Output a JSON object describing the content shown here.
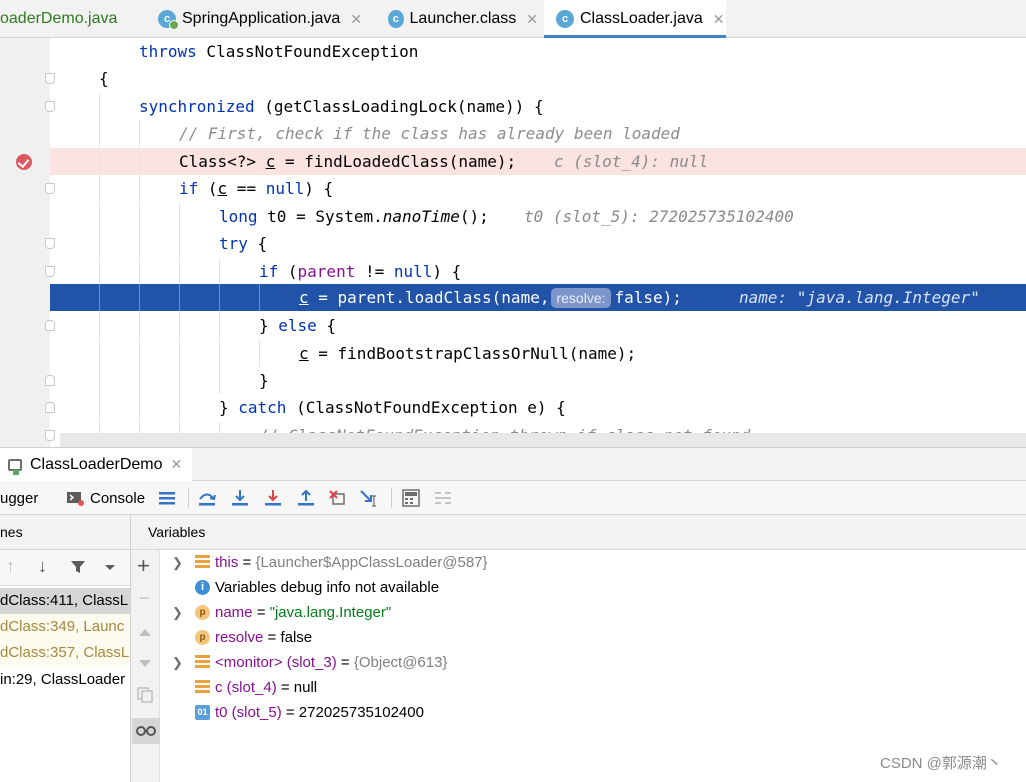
{
  "tabs": [
    {
      "label": "oaderDemo.java",
      "active": false
    },
    {
      "label": "SpringApplication.java",
      "active": false
    },
    {
      "label": "Launcher.class",
      "active": false
    },
    {
      "label": "ClassLoader.java",
      "active": true
    }
  ],
  "tab_close_glyph": "✕",
  "editor": {
    "l1_kw": "throws",
    "l1_rest": " ClassNotFoundException",
    "l2": "{",
    "l3_kw": "synchronized",
    "l3_rest": " (getClassLoadingLock(name)) {",
    "l4_comment": "// First, check if the class has already been loaded",
    "l5_a": "Class<?> ",
    "l5_c": "c",
    "l5_b": " = findLoadedClass(name);",
    "l5_inline": "c (slot_4): null",
    "l6_kw": "if",
    "l6_a": " (",
    "l6_c": "c",
    "l6_b": " == ",
    "l6_null": "null",
    "l6_end": ") {",
    "l7_kw": "long",
    "l7_a": " t0 = System.",
    "l7_it": "nanoTime",
    "l7_b": "();",
    "l7_inline": "t0 (slot_5): 272025735102400",
    "l8_kw": "try",
    "l8_rest": " {",
    "l9_kw": "if",
    "l9_a": " (",
    "l9_fld": "parent",
    "l9_b": " != ",
    "l9_null": "null",
    "l9_end": ") {",
    "l10_c": "c",
    "l10_a": " = parent.loadClass(name,",
    "l10_hint": "resolve:",
    "l10_b": "false);",
    "l10_inline": "name: \"java.lang.Integer\"",
    "l11_a": "} ",
    "l11_kw": "else",
    "l11_b": " {",
    "l12_c": "c",
    "l12_a": " = findBootstrapClassOrNull(name);",
    "l13": "}",
    "l14_a": "} ",
    "l14_kw": "catch",
    "l14_b": " (ClassNotFoundException e) {",
    "l15_comment": "// ClassNotFoundException thrown if class not found"
  },
  "run_tab": {
    "label": "ClassLoaderDemo"
  },
  "toolbar": {
    "debugger_label": "ugger",
    "console_label": "Console"
  },
  "frames_header": "nes",
  "variables_header": "Variables",
  "frames": [
    "dClass:411, ClassL",
    "dClass:349, Launc",
    "dClass:357, ClassL",
    "in:29, ClassLoader"
  ],
  "variables": {
    "v1_name": "this",
    "v1_eq": " = ",
    "v1_val": "{Launcher$AppClassLoader@587}",
    "v2_text": "Variables debug info not available",
    "v3_name": "name",
    "v3_eq": " = ",
    "v3_val": "\"java.lang.Integer\"",
    "v4_name": "resolve",
    "v4_rest": " = false",
    "v5_name": "<monitor> (slot_3)",
    "v5_eq": " = ",
    "v5_val": "{Object@613}",
    "v6_name": "c (slot_4)",
    "v6_rest": " = null",
    "v7_name": "t0 (slot_5)",
    "v7_rest": " = 272025735102400"
  },
  "watermark": "CSDN @郭源潮丶",
  "colors": {
    "keyword": "#0033b3",
    "execution_line": "#2154a8",
    "breakpoint_line": "#fae3e0",
    "active_tab_underline": "#4083c9"
  }
}
